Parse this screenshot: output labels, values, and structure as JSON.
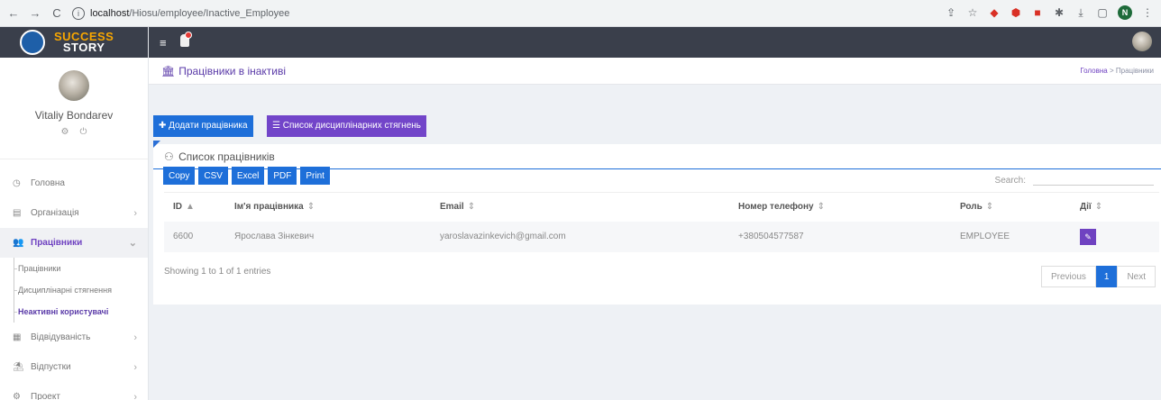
{
  "browser": {
    "url_host": "localhost",
    "url_path": "/Hiosu/employee/Inactive_Employee",
    "profile_initial": "N"
  },
  "sidebar": {
    "logo_line1": "SUCCESS",
    "logo_line2": "STORY",
    "user_name": "Vitaliy Bondarev",
    "menu": [
      {
        "label": "Головна",
        "icon": "home-icon"
      },
      {
        "label": "Організація",
        "icon": "building-icon"
      },
      {
        "label": "Працівники",
        "icon": "users-icon"
      },
      {
        "label": "Відвідуваність",
        "icon": "calendar-icon"
      },
      {
        "label": "Відпустки",
        "icon": "vacation-icon"
      },
      {
        "label": "Проект",
        "icon": "project-icon"
      }
    ],
    "submenu": [
      "Працівники",
      "Дисциплінарні стягнення",
      "Неактивні користувачі"
    ]
  },
  "header": {
    "page_title": "Працівники в інактиві",
    "breadcrumb_home": "Головна",
    "breadcrumb_sep": ">",
    "breadcrumb_current": "Працівники"
  },
  "actions": {
    "add_employee": "Додати працівника",
    "discipline_list": "Список дисциплінарних стягнень"
  },
  "card": {
    "title": "Список працівників",
    "export": [
      "Copy",
      "CSV",
      "Excel",
      "PDF",
      "Print"
    ],
    "search_label": "Search:",
    "columns": [
      "ID",
      "Ім'я працівника",
      "Email",
      "Номер телефону",
      "Роль",
      "Дії"
    ],
    "rows": [
      {
        "id": "6600",
        "name": "Ярослава Зінкевич",
        "email": "yaroslavazinkevich@gmail.com",
        "phone": "+380504577587",
        "role": "EMPLOYEE"
      }
    ],
    "showing": "Showing 1 to 1 of 1 entries",
    "pager": {
      "previous": "Previous",
      "current": "1",
      "next": "Next"
    }
  }
}
